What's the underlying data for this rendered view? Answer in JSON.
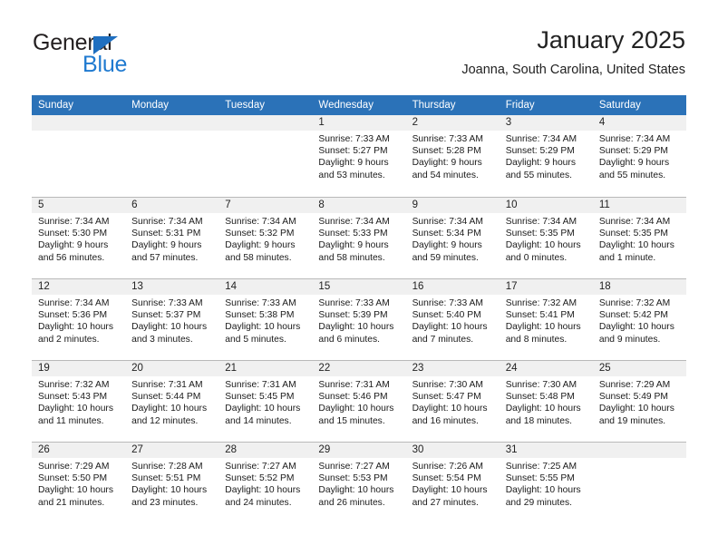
{
  "logo": {
    "text_primary": "General",
    "text_secondary": "Blue",
    "triangle_color": "#1f6fc0",
    "secondary_color": "#1f7ad0"
  },
  "header": {
    "title": "January 2025",
    "subtitle": "Joanna, South Carolina, United States",
    "header_bg_color": "#2b72b8",
    "daynum_bg_color": "#f0f0f0"
  },
  "weekday_headers": [
    "Sunday",
    "Monday",
    "Tuesday",
    "Wednesday",
    "Thursday",
    "Friday",
    "Saturday"
  ],
  "weeks": [
    [
      {
        "day": "",
        "sunrise": "",
        "sunset": "",
        "daylight1": "",
        "daylight2": ""
      },
      {
        "day": "",
        "sunrise": "",
        "sunset": "",
        "daylight1": "",
        "daylight2": ""
      },
      {
        "day": "",
        "sunrise": "",
        "sunset": "",
        "daylight1": "",
        "daylight2": ""
      },
      {
        "day": "1",
        "sunrise": "Sunrise: 7:33 AM",
        "sunset": "Sunset: 5:27 PM",
        "daylight1": "Daylight: 9 hours",
        "daylight2": "and 53 minutes."
      },
      {
        "day": "2",
        "sunrise": "Sunrise: 7:33 AM",
        "sunset": "Sunset: 5:28 PM",
        "daylight1": "Daylight: 9 hours",
        "daylight2": "and 54 minutes."
      },
      {
        "day": "3",
        "sunrise": "Sunrise: 7:34 AM",
        "sunset": "Sunset: 5:29 PM",
        "daylight1": "Daylight: 9 hours",
        "daylight2": "and 55 minutes."
      },
      {
        "day": "4",
        "sunrise": "Sunrise: 7:34 AM",
        "sunset": "Sunset: 5:29 PM",
        "daylight1": "Daylight: 9 hours",
        "daylight2": "and 55 minutes."
      }
    ],
    [
      {
        "day": "5",
        "sunrise": "Sunrise: 7:34 AM",
        "sunset": "Sunset: 5:30 PM",
        "daylight1": "Daylight: 9 hours",
        "daylight2": "and 56 minutes."
      },
      {
        "day": "6",
        "sunrise": "Sunrise: 7:34 AM",
        "sunset": "Sunset: 5:31 PM",
        "daylight1": "Daylight: 9 hours",
        "daylight2": "and 57 minutes."
      },
      {
        "day": "7",
        "sunrise": "Sunrise: 7:34 AM",
        "sunset": "Sunset: 5:32 PM",
        "daylight1": "Daylight: 9 hours",
        "daylight2": "and 58 minutes."
      },
      {
        "day": "8",
        "sunrise": "Sunrise: 7:34 AM",
        "sunset": "Sunset: 5:33 PM",
        "daylight1": "Daylight: 9 hours",
        "daylight2": "and 58 minutes."
      },
      {
        "day": "9",
        "sunrise": "Sunrise: 7:34 AM",
        "sunset": "Sunset: 5:34 PM",
        "daylight1": "Daylight: 9 hours",
        "daylight2": "and 59 minutes."
      },
      {
        "day": "10",
        "sunrise": "Sunrise: 7:34 AM",
        "sunset": "Sunset: 5:35 PM",
        "daylight1": "Daylight: 10 hours",
        "daylight2": "and 0 minutes."
      },
      {
        "day": "11",
        "sunrise": "Sunrise: 7:34 AM",
        "sunset": "Sunset: 5:35 PM",
        "daylight1": "Daylight: 10 hours",
        "daylight2": "and 1 minute."
      }
    ],
    [
      {
        "day": "12",
        "sunrise": "Sunrise: 7:34 AM",
        "sunset": "Sunset: 5:36 PM",
        "daylight1": "Daylight: 10 hours",
        "daylight2": "and 2 minutes."
      },
      {
        "day": "13",
        "sunrise": "Sunrise: 7:33 AM",
        "sunset": "Sunset: 5:37 PM",
        "daylight1": "Daylight: 10 hours",
        "daylight2": "and 3 minutes."
      },
      {
        "day": "14",
        "sunrise": "Sunrise: 7:33 AM",
        "sunset": "Sunset: 5:38 PM",
        "daylight1": "Daylight: 10 hours",
        "daylight2": "and 5 minutes."
      },
      {
        "day": "15",
        "sunrise": "Sunrise: 7:33 AM",
        "sunset": "Sunset: 5:39 PM",
        "daylight1": "Daylight: 10 hours",
        "daylight2": "and 6 minutes."
      },
      {
        "day": "16",
        "sunrise": "Sunrise: 7:33 AM",
        "sunset": "Sunset: 5:40 PM",
        "daylight1": "Daylight: 10 hours",
        "daylight2": "and 7 minutes."
      },
      {
        "day": "17",
        "sunrise": "Sunrise: 7:32 AM",
        "sunset": "Sunset: 5:41 PM",
        "daylight1": "Daylight: 10 hours",
        "daylight2": "and 8 minutes."
      },
      {
        "day": "18",
        "sunrise": "Sunrise: 7:32 AM",
        "sunset": "Sunset: 5:42 PM",
        "daylight1": "Daylight: 10 hours",
        "daylight2": "and 9 minutes."
      }
    ],
    [
      {
        "day": "19",
        "sunrise": "Sunrise: 7:32 AM",
        "sunset": "Sunset: 5:43 PM",
        "daylight1": "Daylight: 10 hours",
        "daylight2": "and 11 minutes."
      },
      {
        "day": "20",
        "sunrise": "Sunrise: 7:31 AM",
        "sunset": "Sunset: 5:44 PM",
        "daylight1": "Daylight: 10 hours",
        "daylight2": "and 12 minutes."
      },
      {
        "day": "21",
        "sunrise": "Sunrise: 7:31 AM",
        "sunset": "Sunset: 5:45 PM",
        "daylight1": "Daylight: 10 hours",
        "daylight2": "and 14 minutes."
      },
      {
        "day": "22",
        "sunrise": "Sunrise: 7:31 AM",
        "sunset": "Sunset: 5:46 PM",
        "daylight1": "Daylight: 10 hours",
        "daylight2": "and 15 minutes."
      },
      {
        "day": "23",
        "sunrise": "Sunrise: 7:30 AM",
        "sunset": "Sunset: 5:47 PM",
        "daylight1": "Daylight: 10 hours",
        "daylight2": "and 16 minutes."
      },
      {
        "day": "24",
        "sunrise": "Sunrise: 7:30 AM",
        "sunset": "Sunset: 5:48 PM",
        "daylight1": "Daylight: 10 hours",
        "daylight2": "and 18 minutes."
      },
      {
        "day": "25",
        "sunrise": "Sunrise: 7:29 AM",
        "sunset": "Sunset: 5:49 PM",
        "daylight1": "Daylight: 10 hours",
        "daylight2": "and 19 minutes."
      }
    ],
    [
      {
        "day": "26",
        "sunrise": "Sunrise: 7:29 AM",
        "sunset": "Sunset: 5:50 PM",
        "daylight1": "Daylight: 10 hours",
        "daylight2": "and 21 minutes."
      },
      {
        "day": "27",
        "sunrise": "Sunrise: 7:28 AM",
        "sunset": "Sunset: 5:51 PM",
        "daylight1": "Daylight: 10 hours",
        "daylight2": "and 23 minutes."
      },
      {
        "day": "28",
        "sunrise": "Sunrise: 7:27 AM",
        "sunset": "Sunset: 5:52 PM",
        "daylight1": "Daylight: 10 hours",
        "daylight2": "and 24 minutes."
      },
      {
        "day": "29",
        "sunrise": "Sunrise: 7:27 AM",
        "sunset": "Sunset: 5:53 PM",
        "daylight1": "Daylight: 10 hours",
        "daylight2": "and 26 minutes."
      },
      {
        "day": "30",
        "sunrise": "Sunrise: 7:26 AM",
        "sunset": "Sunset: 5:54 PM",
        "daylight1": "Daylight: 10 hours",
        "daylight2": "and 27 minutes."
      },
      {
        "day": "31",
        "sunrise": "Sunrise: 7:25 AM",
        "sunset": "Sunset: 5:55 PM",
        "daylight1": "Daylight: 10 hours",
        "daylight2": "and 29 minutes."
      },
      {
        "day": "",
        "sunrise": "",
        "sunset": "",
        "daylight1": "",
        "daylight2": ""
      }
    ]
  ]
}
